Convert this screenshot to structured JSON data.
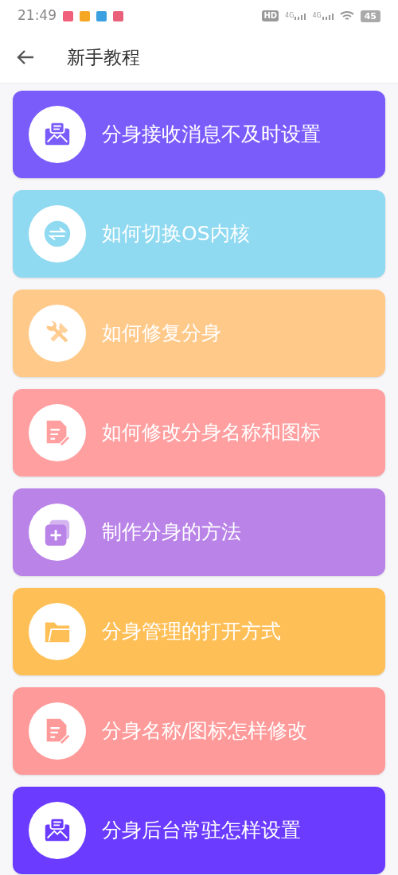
{
  "status_bar": {
    "time": "21:49",
    "notifications": [
      {
        "color": "#f0607a"
      },
      {
        "color": "#f5a623"
      },
      {
        "color": "#3aa0e0"
      },
      {
        "color": "#e8607a"
      }
    ],
    "hd": "HD",
    "networks": [
      "4G",
      "4G"
    ],
    "battery": "45"
  },
  "header": {
    "title": "新手教程"
  },
  "tutorials": [
    {
      "title": "分身接收消息不及时设置",
      "kind": "mail",
      "color": "#7a5cfb"
    },
    {
      "title": "如何切换OS内核",
      "kind": "switch",
      "color": "#8fd9f1"
    },
    {
      "title": "如何修复分身",
      "kind": "tools",
      "color": "#ffc98a"
    },
    {
      "title": "如何修改分身名称和图标",
      "kind": "edit",
      "color": "#ff9fa0"
    },
    {
      "title": "制作分身的方法",
      "kind": "add",
      "color": "#b983e8"
    },
    {
      "title": "分身管理的打开方式",
      "kind": "folder",
      "color": "#ffbf57"
    },
    {
      "title": "分身名称/图标怎样修改",
      "kind": "edit",
      "color": "#ff9a9a"
    },
    {
      "title": "分身后台常驻怎样设置",
      "kind": "mail",
      "color": "#6b3cff"
    }
  ]
}
